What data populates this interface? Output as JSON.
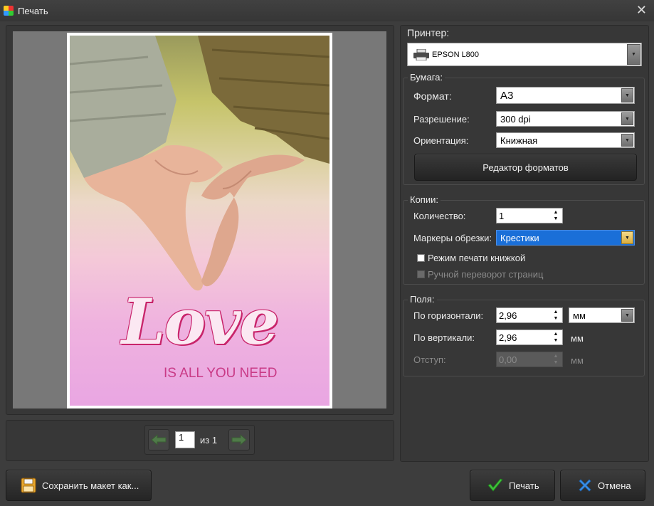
{
  "window": {
    "title": "Печать",
    "close_glyph": "✕"
  },
  "preview": {
    "image_text_main": "Love",
    "image_text_sub": "IS ALL YOU NEED",
    "page_current": "1",
    "page_of": "из 1"
  },
  "printer": {
    "label": "Принтер:",
    "selected": "EPSON L800",
    "icon": "printer-icon"
  },
  "paper": {
    "group_title": "Бумага:",
    "format_label": "Формат:",
    "format_value": "A3",
    "resolution_label": "Разрешение:",
    "resolution_value": "300 dpi",
    "orientation_label": "Ориентация:",
    "orientation_value": "Книжная",
    "editor_button": "Редактор форматов"
  },
  "copies": {
    "group_title": "Копии:",
    "quantity_label": "Количество:",
    "quantity_value": "1",
    "crop_marks_label": "Маркеры обрезки:",
    "crop_marks_value": "Крестики",
    "booklet_label": "Режим печати книжкой",
    "manual_flip_label": "Ручной переворот страниц"
  },
  "margins": {
    "group_title": "Поля:",
    "horizontal_label": "По горизонтали:",
    "horizontal_value": "2,96",
    "vertical_label": "По вертикали:",
    "vertical_value": "2,96",
    "indent_label": "Отступ:",
    "indent_value": "0,00",
    "unit_select": "мм",
    "unit_vertical": "мм",
    "unit_indent": "мм"
  },
  "buttons": {
    "save_layout": "Сохранить макет как...",
    "print": "Печать",
    "cancel": "Отмена"
  },
  "colors": {
    "accent_selection": "#1a6fd8",
    "ok_green": "#39b54a",
    "cancel_blue": "#3a8fe8"
  }
}
